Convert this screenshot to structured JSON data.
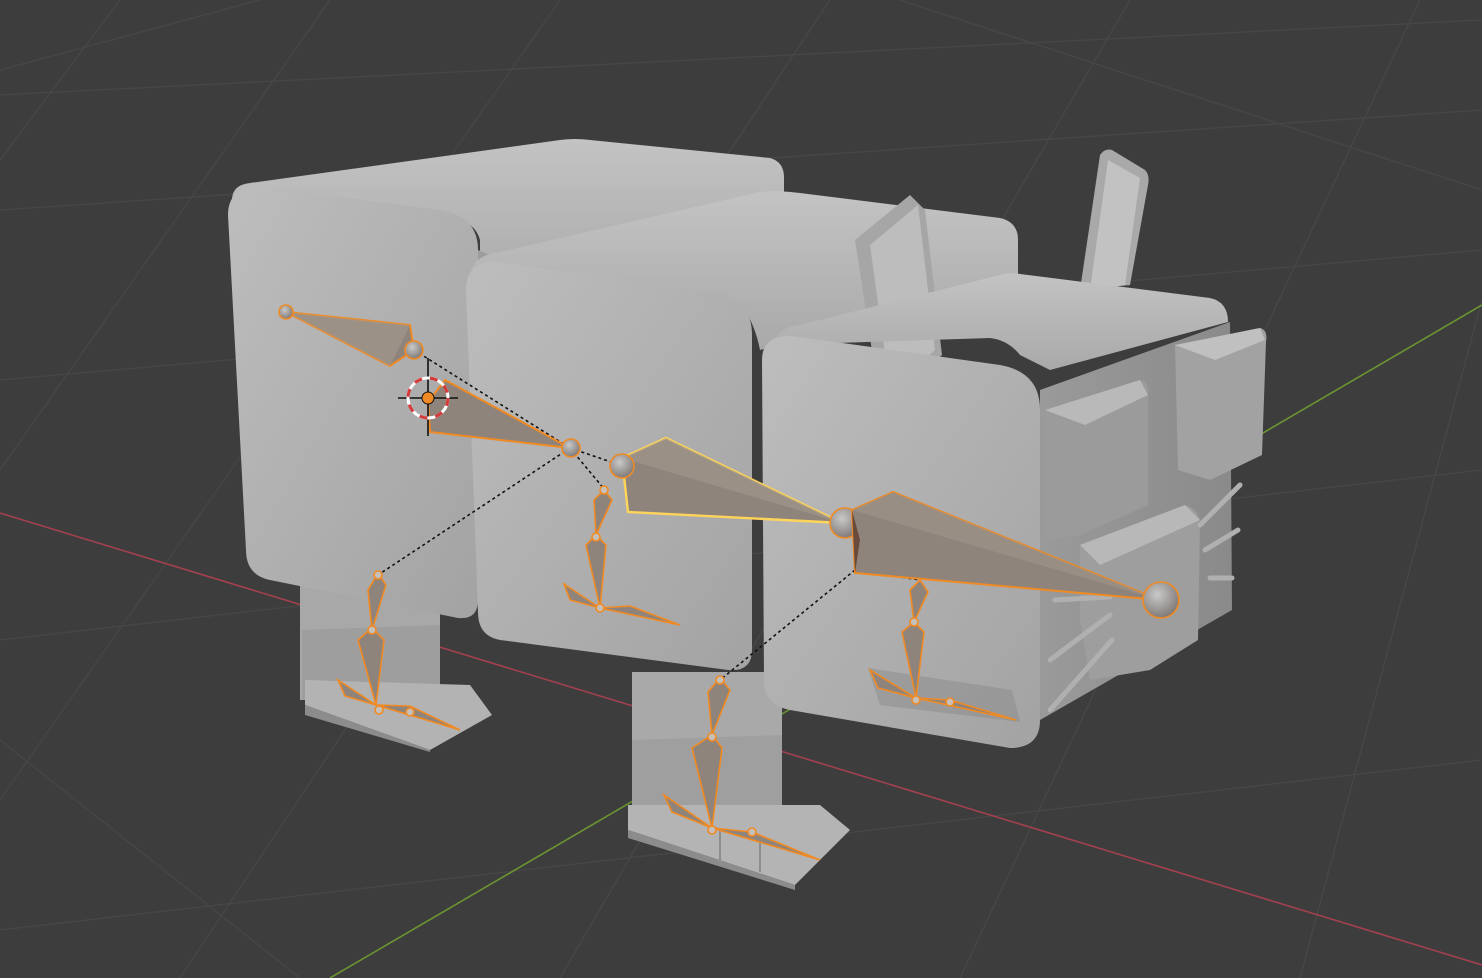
{
  "viewport": {
    "background": "#3d3d3d",
    "grid_color": "#474747",
    "x_axis_color": "#a3404f",
    "y_axis_color": "#6a9530"
  },
  "model": {
    "mesh_color": "#b7b7b7",
    "mesh_shadow": "#8f8f8f",
    "mesh_highlight": "#cfcfcf"
  },
  "armature": {
    "bone_fill": "#8e847b",
    "bone_outline": "#f08a24",
    "active_bone_outline": "#ffd45a",
    "relationship_line": "#111111"
  },
  "cursor_3d": {
    "ring_red": "#d63b3b",
    "ring_white": "#ffffff",
    "center": "#f08a24"
  },
  "icons": [
    "3d-cursor-icon"
  ]
}
